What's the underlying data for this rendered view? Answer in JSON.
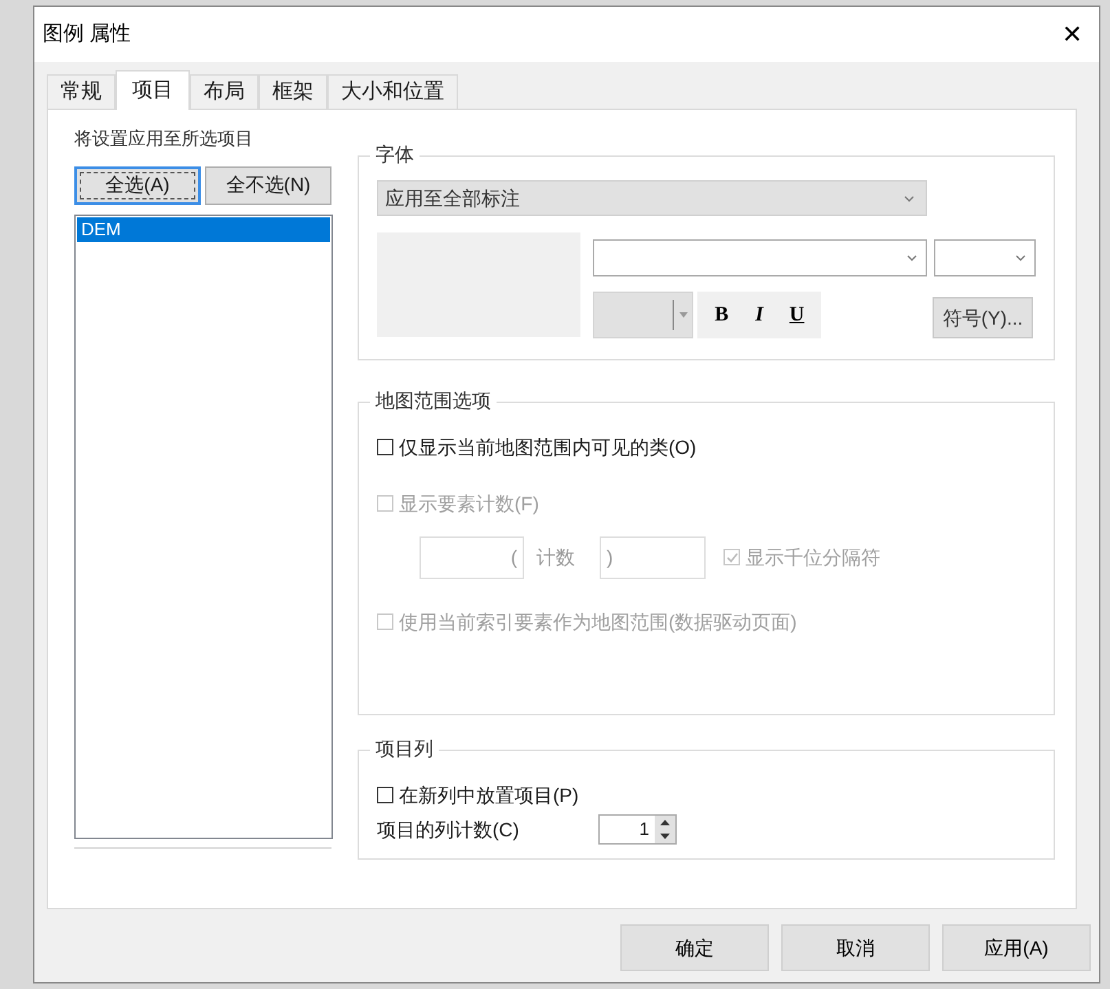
{
  "window": {
    "title": "图例 属性",
    "close": "✕"
  },
  "tabs": [
    {
      "label": "常规",
      "selected": false
    },
    {
      "label": "项目",
      "selected": true
    },
    {
      "label": "布局",
      "selected": false
    },
    {
      "label": "框架",
      "selected": false
    },
    {
      "label": "大小和位置",
      "selected": false
    }
  ],
  "items_panel": {
    "caption": "将设置应用至所选项目",
    "buttons": [
      {
        "label": "全选(A)",
        "focused": true
      },
      {
        "label": "全不选(N)",
        "focused": false
      }
    ],
    "list": [
      {
        "label": "DEM",
        "selected": true
      }
    ]
  },
  "font_group": {
    "title": "字体",
    "apply_dropdown": "应用至全部标注",
    "style_buttons": [
      {
        "label": "B",
        "kind": "bold"
      },
      {
        "label": "I",
        "kind": "italic"
      },
      {
        "label": "U",
        "kind": "underline"
      }
    ],
    "symbol_button": "符号(Y)..."
  },
  "map_extent_group": {
    "title": "地图范围选项",
    "options": [
      {
        "kind": "checkbox",
        "label": "仅显示当前地图范围内可见的类(O)",
        "checked": false,
        "disabled": false
      },
      {
        "kind": "checkbox",
        "label": "显示要素计数(F)",
        "checked": false,
        "disabled": true
      },
      {
        "kind": "count_format",
        "open": "(",
        "middle": "计数",
        "close": ")",
        "separator": {
          "label": "显示千位分隔符",
          "checked": true,
          "disabled": true
        }
      },
      {
        "kind": "checkbox",
        "label": "使用当前索引要素作为地图范围(数据驱动页面)",
        "checked": false,
        "disabled": true
      }
    ]
  },
  "columns_group": {
    "title": "项目列",
    "new_column": {
      "label": "在新列中放置项目(P)",
      "checked": false
    },
    "count_label": "项目的列计数(C)",
    "count_value": "1"
  },
  "footer_buttons": [
    "确定",
    "取消",
    "应用(A)"
  ]
}
